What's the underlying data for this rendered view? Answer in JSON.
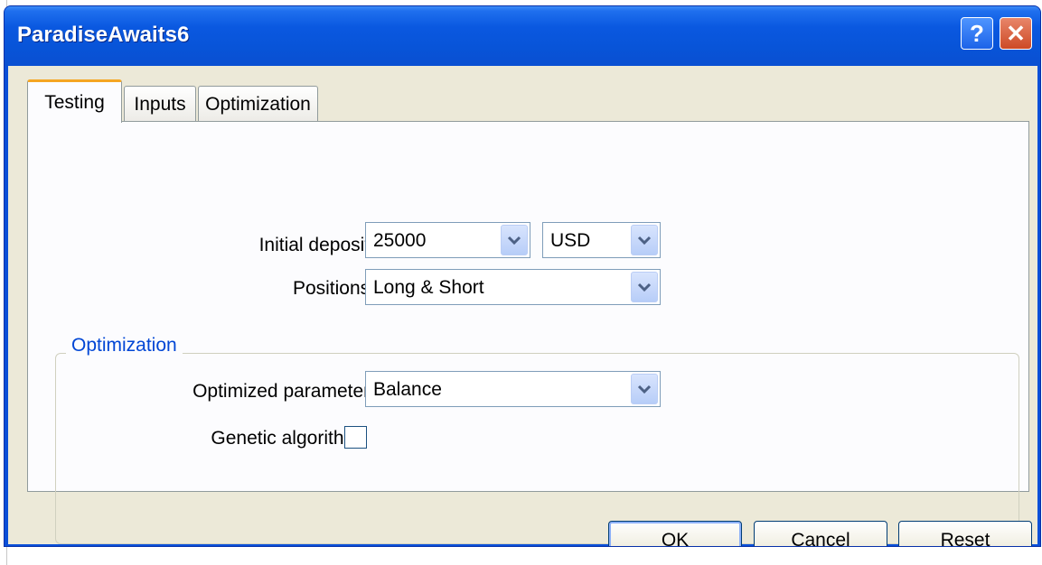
{
  "window": {
    "title": "ParadiseAwaits6",
    "help_glyph": "?",
    "close_glyph": "✕"
  },
  "tabs": [
    {
      "label": "Testing",
      "active": true
    },
    {
      "label": "Inputs",
      "active": false
    },
    {
      "label": "Optimization",
      "active": false
    }
  ],
  "testing": {
    "initial_deposit_label": "Initial deposit:",
    "initial_deposit_value": "25000",
    "currency_value": "USD",
    "positions_label": "Positions:",
    "positions_value": "Long & Short",
    "optimization_group_title": "Optimization",
    "optimized_parameter_label": "Optimized parameter:",
    "optimized_parameter_value": "Balance",
    "genetic_algorithm_label": "Genetic algorithm",
    "genetic_algorithm_checked": false
  },
  "buttons": {
    "ok": "OK",
    "cancel": "Cancel",
    "reset": "Reset"
  },
  "colors": {
    "title_bar": "#0a58e0",
    "dialog_background": "#ece9d8",
    "active_tab_accent": "#f5a623",
    "group_title": "#0046d5"
  },
  "icons": {
    "help": "help-icon",
    "close": "close-icon",
    "dropdown": "chevron-down-icon"
  }
}
